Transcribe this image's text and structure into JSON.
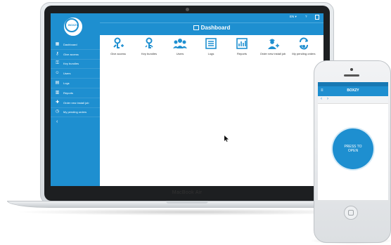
{
  "laptop": {
    "brand_text": "MacBook Air"
  },
  "app": {
    "logo_text": "BOXZY",
    "topbar": {
      "lang": "EN ▾",
      "help": "?"
    },
    "title": "Dashboard",
    "sidebar": {
      "items": [
        {
          "label": "Dashboard",
          "icon": "dashboard-icon"
        },
        {
          "label": "Give access",
          "icon": "key-icon"
        },
        {
          "label": "Key bundles",
          "icon": "key-bundle-icon"
        },
        {
          "label": "Users",
          "icon": "users-icon"
        },
        {
          "label": "Logs",
          "icon": "logs-icon"
        },
        {
          "label": "Reports",
          "icon": "reports-icon"
        },
        {
          "label": "Order new install job",
          "icon": "install-job-icon"
        },
        {
          "label": "My pending orders",
          "icon": "pending-orders-icon"
        }
      ],
      "collapse": "‹"
    },
    "tiles": [
      {
        "label": "Give access",
        "icon": "give-access-icon"
      },
      {
        "label": "Key bundles",
        "icon": "key-bundles-icon"
      },
      {
        "label": "Users",
        "icon": "users-icon"
      },
      {
        "label": "Logs",
        "icon": "logs-icon"
      },
      {
        "label": "Reports",
        "icon": "reports-icon"
      },
      {
        "label": "Order new install job",
        "icon": "order-install-icon"
      },
      {
        "label": "My pending orders",
        "icon": "pending-orders-icon"
      }
    ],
    "accent_color": "#1e8fd0"
  },
  "phone": {
    "app_title": "BOXZY",
    "open_button": "PRESS TO OPEN"
  }
}
